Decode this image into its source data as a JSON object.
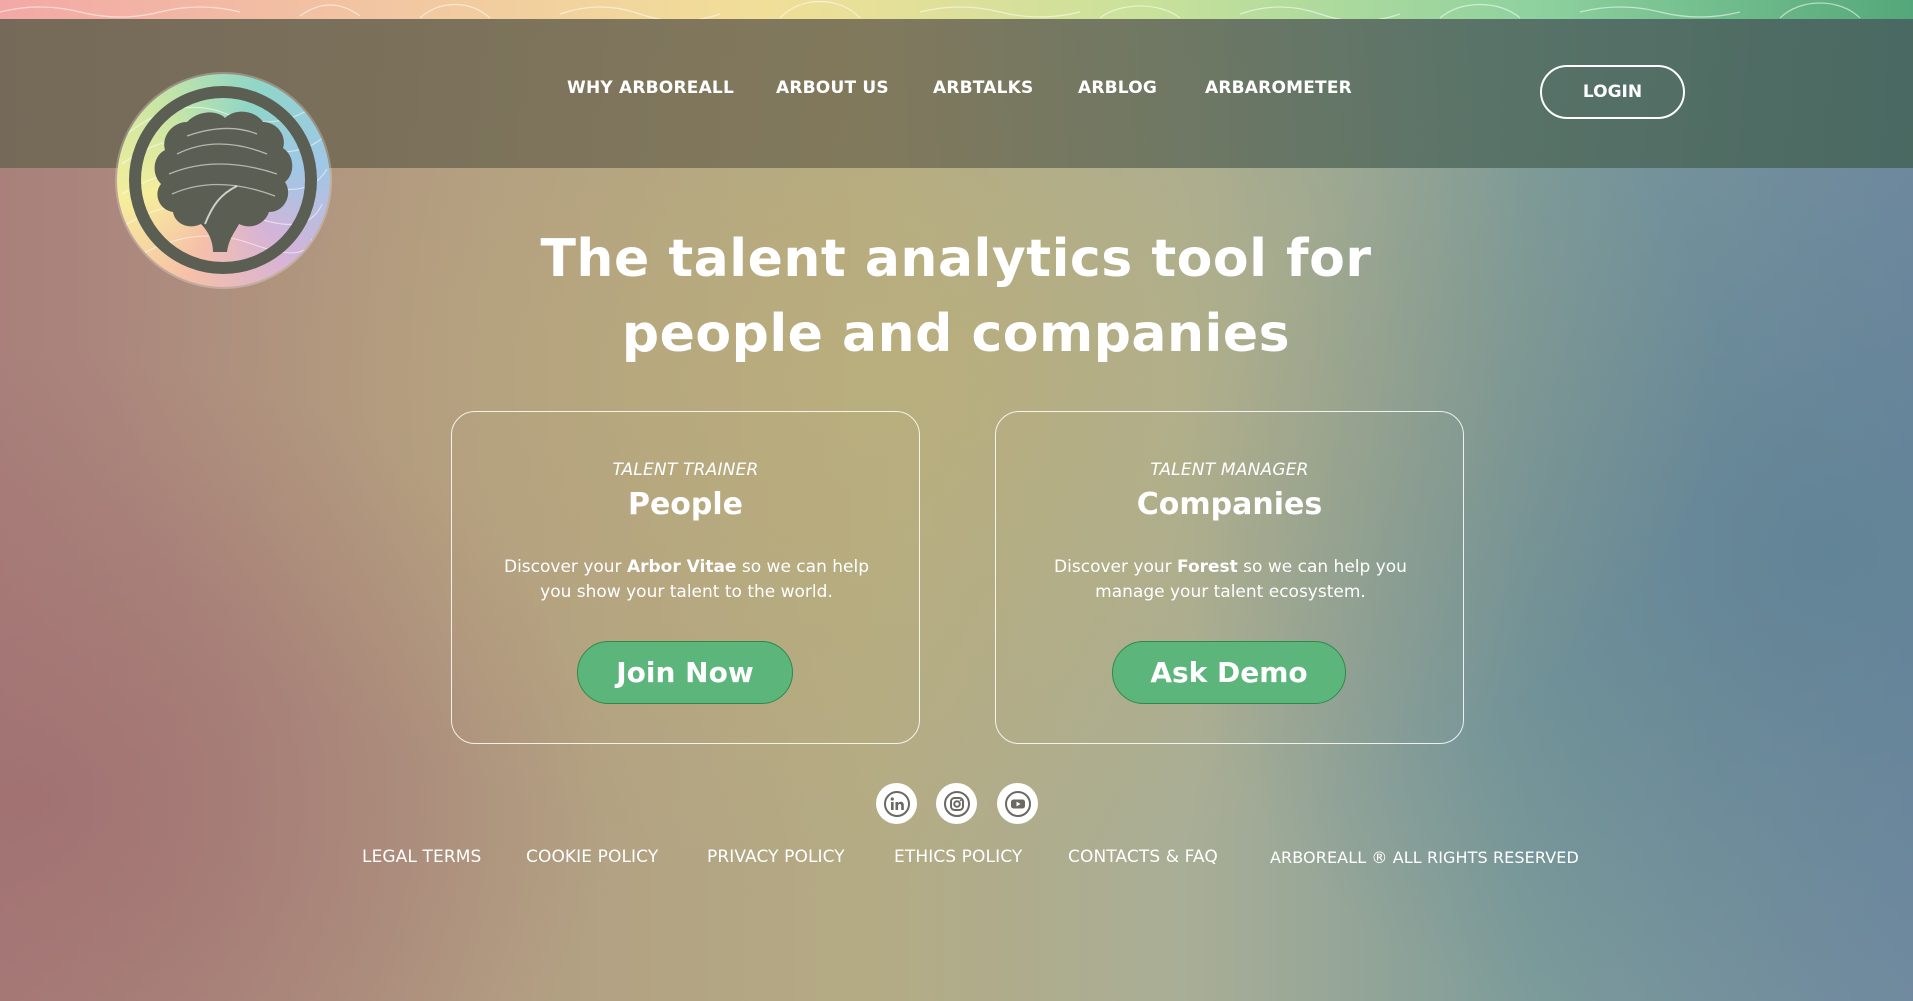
{
  "brand": {
    "name": "ARBOREALL",
    "colors": {
      "accent_green": "#5cb67c",
      "header_overlay": "#6e6654",
      "text": "#ffffff"
    }
  },
  "nav": {
    "items": [
      {
        "label": "WHY ARBOREALL"
      },
      {
        "label": "ARBOUT US"
      },
      {
        "label": "ARBTALKS"
      },
      {
        "label": "ARBLOG"
      },
      {
        "label": "ARBAROMETER"
      }
    ],
    "login_label": "LOGIN"
  },
  "hero": {
    "title_line1": "The talent analytics tool for",
    "title_line2": "people and companies"
  },
  "cards": {
    "people": {
      "kicker": "TALENT TRAINER",
      "title": "People",
      "desc_pre": "Discover your ",
      "desc_bold": "Arbor Vitae",
      "desc_post": " so we can help you show your talent to the world.",
      "button": "Join Now"
    },
    "companies": {
      "kicker": "TALENT MANAGER",
      "title": "Companies",
      "desc_pre": "Discover your ",
      "desc_bold": "Forest",
      "desc_post": " so we can help you manage your talent ecosystem.",
      "button": "Ask Demo"
    }
  },
  "socials": [
    {
      "icon": "linkedin-icon"
    },
    {
      "icon": "instagram-icon"
    },
    {
      "icon": "youtube-icon"
    }
  ],
  "footer": {
    "links": [
      {
        "label": "LEGAL TERMS"
      },
      {
        "label": "COOKIE POLICY"
      },
      {
        "label": "PRIVACY POLICY"
      },
      {
        "label": "ETHICS POLICY"
      },
      {
        "label": "CONTACTS & FAQ"
      }
    ],
    "copyright": "ARBOREALL ® ALL RIGHTS RESERVED"
  }
}
